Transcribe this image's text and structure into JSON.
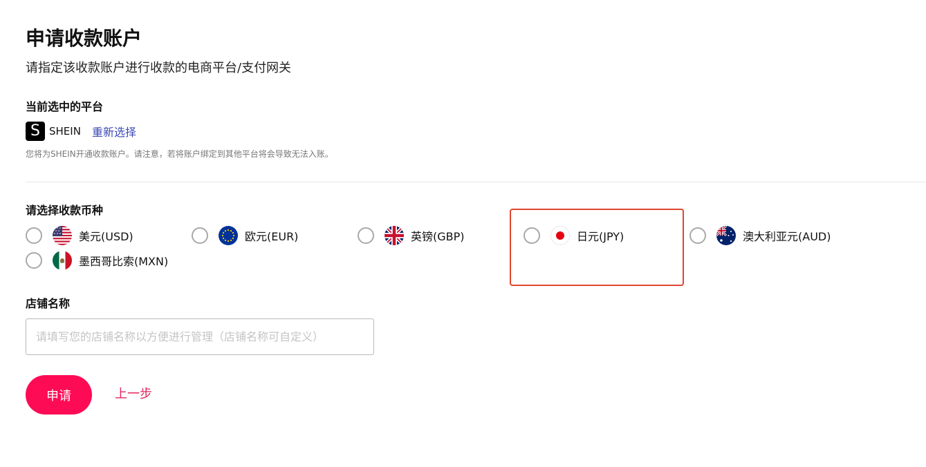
{
  "header": {
    "title": "申请收款账户",
    "subtitle": "请指定该收款账户进行收款的电商平台/支付网关"
  },
  "platform": {
    "section_label": "当前选中的平台",
    "logo_letter": "S",
    "name": "SHEIN",
    "reselect_label": "重新选择",
    "notice": "您将为SHEIN开通收款账户。请注意，若将账户绑定到其他平台将会导致无法入账。"
  },
  "currency": {
    "section_label": "请选择收款币种",
    "options": [
      {
        "label": "美元(USD)",
        "flag": "us-flag-icon",
        "selected": false
      },
      {
        "label": "欧元(EUR)",
        "flag": "eu-flag-icon",
        "selected": false
      },
      {
        "label": "英镑(GBP)",
        "flag": "uk-flag-icon",
        "selected": false
      },
      {
        "label": "日元(JPY)",
        "flag": "jp-flag-icon",
        "selected": false,
        "highlighted": true
      },
      {
        "label": "澳大利亚元(AUD)",
        "flag": "au-flag-icon",
        "selected": false
      },
      {
        "label": "墨西哥比索(MXN)",
        "flag": "mx-flag-icon",
        "selected": false
      }
    ],
    "highlight_color": "#e0452f"
  },
  "store": {
    "section_label": "店铺名称",
    "value": "",
    "placeholder": "请填写您的店铺名称以方便进行管理（店铺名称可自定义）"
  },
  "actions": {
    "apply_label": "申请",
    "back_label": "上一步",
    "apply_color": "#fe0b55",
    "back_color": "#e0255c",
    "link_color": "#3d4bb5"
  }
}
